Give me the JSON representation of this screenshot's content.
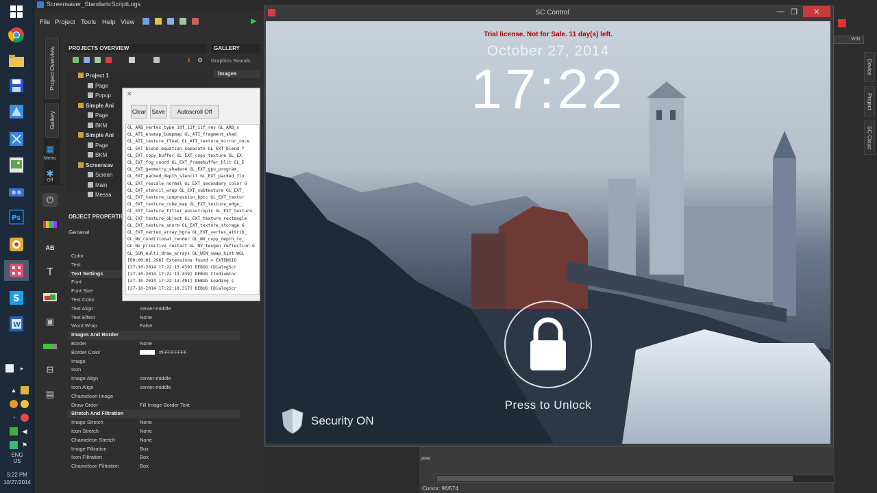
{
  "taskbar": {
    "language": "ENG\nUS",
    "time": "5:22 PM",
    "date": "10/27/2014"
  },
  "editor": {
    "title": "Screensaver_Standart«ScriptLogs",
    "menu": [
      "File",
      "Project",
      "Tools",
      "Help",
      "View"
    ],
    "side_tabs": [
      "Project Overview",
      "Gallery"
    ],
    "side_icons": [
      {
        "icon": "metro-icon",
        "label": "Metro"
      },
      {
        "icon": "off-icon",
        "label": "Off"
      }
    ],
    "projects_overview": {
      "header": "PROJECTS OVERVIEW",
      "tree": [
        {
          "label": "Project 1",
          "bold": true,
          "indent": 0
        },
        {
          "label": "Page",
          "bold": false,
          "indent": 1
        },
        {
          "label": "Popup",
          "bold": false,
          "indent": 1
        },
        {
          "label": "Simple Ani",
          "bold": true,
          "indent": 0
        },
        {
          "label": "Page",
          "bold": false,
          "indent": 1
        },
        {
          "label": "BKM",
          "bold": false,
          "indent": 1
        },
        {
          "label": "Simple Ani",
          "bold": true,
          "indent": 0
        },
        {
          "label": "Page",
          "bold": false,
          "indent": 1
        },
        {
          "label": "BKM",
          "bold": false,
          "indent": 1
        },
        {
          "label": "Screensav",
          "bold": true,
          "indent": 0
        },
        {
          "label": "Screen",
          "bold": false,
          "indent": 1
        },
        {
          "label": "Main",
          "bold": false,
          "indent": 1
        },
        {
          "label": "Messa",
          "bold": false,
          "indent": 1
        }
      ]
    },
    "gallery": {
      "header": "GALLERY",
      "tabs": "Graphics  Sounds",
      "section": "Images"
    },
    "object_properties": {
      "header": "OBJECT PROPERTIES",
      "tab": "General",
      "rows": [
        {
          "k": "Color",
          "v": "",
          "sec": false
        },
        {
          "k": "Text",
          "v": "",
          "sec": false
        },
        {
          "k": "Text Settings",
          "v": "",
          "sec": true
        },
        {
          "k": "Font",
          "v": "",
          "sec": false
        },
        {
          "k": "Font Size",
          "v": "",
          "sec": false
        },
        {
          "k": "Text Color",
          "v": "",
          "sec": false
        },
        {
          "k": "Text Align",
          "v": "center-middle",
          "sec": false
        },
        {
          "k": "Text Effect",
          "v": "None",
          "sec": false
        },
        {
          "k": "Word Wrap",
          "v": "False",
          "sec": false
        },
        {
          "k": "Images And Border",
          "v": "",
          "sec": true
        },
        {
          "k": "Border",
          "v": "None",
          "sec": false
        },
        {
          "k": "Border Color",
          "v": "#FFFFFFFF",
          "sec": false,
          "swatch": true
        },
        {
          "k": "Image",
          "v": "",
          "sec": false
        },
        {
          "k": "Icon",
          "v": "",
          "sec": false
        },
        {
          "k": "Image Align",
          "v": "center-middle",
          "sec": false
        },
        {
          "k": "Icon Align",
          "v": "center-middle",
          "sec": false
        },
        {
          "k": "Chameleon Image",
          "v": "",
          "sec": false
        },
        {
          "k": "Draw Order",
          "v": "Fill Image Border Text",
          "sec": false
        },
        {
          "k": "Stretch And Filtration",
          "v": "",
          "sec": true
        },
        {
          "k": "Image Stretch",
          "v": "None",
          "sec": false
        },
        {
          "k": "Icon Stretch",
          "v": "None",
          "sec": false
        },
        {
          "k": "Chameleon Stretch",
          "v": "None",
          "sec": false
        },
        {
          "k": "Image Filtration",
          "v": "Box",
          "sec": false
        },
        {
          "k": "Icon Filtration",
          "v": "Box",
          "sec": false
        },
        {
          "k": "Chameleon Filtration",
          "v": "Box",
          "sec": false
        }
      ]
    }
  },
  "log_window": {
    "buttons": [
      "Clear",
      "Save",
      "Autoscroll Off"
    ],
    "lines": [
      "GL_ARB_vertex_type_10f_11f_11f_rev GL_ARB_v",
      "GL_ATI_envmap_bumpmap GL_ATI_fragment_shad",
      "GL_ATI_texture_float GL_ATI_texture_mirror_once",
      "GL_EXT_blend_equation_separate GL_EXT_blend_f",
      "GL_EXT_copy_buffer GL_EXT_copy_texture GL_EX",
      "GL_EXT_fog_coord GL_EXT_framebuffer_blit GL_E",
      "GL_EXT_geometry_shader4 GL_EXT_gpu_program_",
      "GL_EXT_packed_depth_stencil GL_EXT_packed_flo",
      "GL_EXT_rescale_normal GL_EXT_secondary_color G",
      "GL_EXT_stencil_wrap GL_EXT_subtexture GL_EXT_",
      "GL_EXT_texture_compression_bptc GL_EXT_textur",
      "GL_EXT_texture_cube_map GL_EXT_texture_edge_",
      "GL_EXT_texture_filter_anisotropic GL_EXT_texture",
      "GL_EXT_texture_object GL_EXT_texture_rectangle",
      "GL_EXT_texture_snorm GL_EXT_texture_storage G",
      "GL_EXT_vertex_array_bgra GL_EXT_vertex_attrib_",
      "GL_NV_conditional_render GL_NV_copy_depth_to_",
      "GL_NV_primitive_restart GL_NV_texgen_reflection G",
      "GL_SUN_multi_draw_arrays GL_WIN_swap_hint WGL",
      "[00:00:01.296]      Extensions found = EXTENSIO",
      "[27-10-2014 17:22:13.439]   DEBUG    CDialogScr",
      "[27-10-2014 17:22:13.439]   DEBUG    CIndiumCor",
      "[27-10-2014 17:22:13.491]   DEBUG    Loading s",
      "[27-10-2014 17:22:18.317]   DEBUG    CDialogScr"
    ]
  },
  "preview": {
    "title": "SC Control",
    "trial_notice": "Trial license. Not for Sale. 11 day(s) left.",
    "date": "October 27, 2014",
    "time": "17:22",
    "unlock": "Press to Unlock",
    "security": "Security ON"
  },
  "right_panel": {
    "tabs": [
      "Device",
      "Project",
      "SC Cloud"
    ],
    "field": "WIN"
  },
  "status": {
    "cursor": "Cursor: 96/574",
    "zoom": "25%"
  }
}
